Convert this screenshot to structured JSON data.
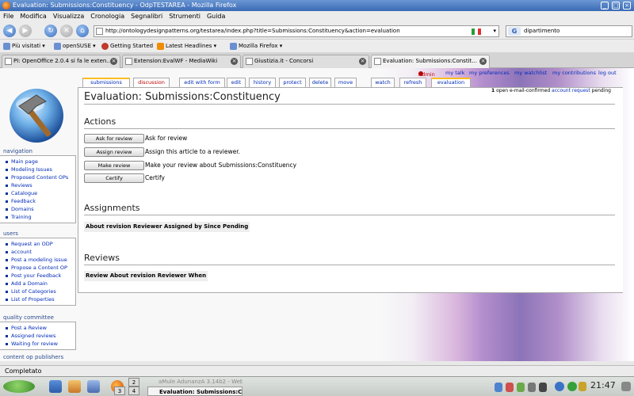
{
  "window": {
    "title": "Evaluation: Submissions:Constituency - OdpTESTAREA - Mozilla Firefox"
  },
  "menubar": [
    "File",
    "Modifica",
    "Visualizza",
    "Cronologia",
    "Segnalibri",
    "Strumenti",
    "Guida"
  ],
  "navbar": {
    "url": "http://ontologydesignpatterns.org/testarea/index.php?title=Submissions:Constituency&action=evaluation",
    "search_value": "dipartimento"
  },
  "bookmarks": [
    "Più visitati",
    "openSUSE",
    "Getting Started",
    "Latest Headlines",
    "Mozilla Firefox"
  ],
  "tabs": [
    {
      "label": "PI: OpenOffice 2.0.4 si fa le exten..."
    },
    {
      "label": "Extension:EvalWF - MediaWiki"
    },
    {
      "label": "Giustizia.it - Concorsi"
    },
    {
      "label": "Evaluation: Submissions:Constit..."
    }
  ],
  "personal": {
    "user": "Admin",
    "items": [
      "my talk",
      "my preferences",
      "my watchlist",
      "my contributions",
      "log out"
    ]
  },
  "ctabs": [
    "submissions",
    "discussion",
    "edit with form",
    "edit",
    "history",
    "protect",
    "delete",
    "move",
    "watch",
    "refresh",
    "evaluation"
  ],
  "page": {
    "title": "Evaluation: Submissions:Constituency",
    "pending_count": "1",
    "pending_text1": "open e-mail-confirmed",
    "pending_link": "account request",
    "pending_text2": "pending"
  },
  "actions": {
    "heading": "Actions",
    "items": [
      {
        "button": "Ask for review",
        "desc": "Ask for review"
      },
      {
        "button": "Assign review",
        "desc": "Assign this article to a reviewer."
      },
      {
        "button": "Make review",
        "desc": "Make your review about Submissions:Constituency"
      },
      {
        "button": "Certify",
        "desc": "Certify"
      }
    ]
  },
  "assignments": {
    "heading": "Assignments",
    "columns": "About revision Reviewer Assigned by Since Pending"
  },
  "reviews": {
    "heading": "Reviews",
    "columns": "Review About revision Reviewer When"
  },
  "sidebar": {
    "navigation": {
      "heading": "navigation",
      "items": [
        "Main page",
        "Modeling Issues",
        "Proposed Content OPs",
        "Reviews",
        "Catalogue",
        "Feedback",
        "Domains",
        "Training"
      ]
    },
    "users": {
      "heading": "users",
      "items": [
        "Request an ODP",
        "account",
        "Post a modeling issue",
        "Propose a Content OP",
        "Post your Feedback",
        "Add a Domain",
        "List of Categories",
        "List of Properties"
      ]
    },
    "quality": {
      "heading": "quality committee",
      "items": [
        "Post a Review",
        "Assigned reviews",
        "Waiting for review"
      ]
    },
    "content_op": {
      "heading": "content op publishers"
    }
  },
  "statusbar": {
    "text": "Completato"
  },
  "taskbar": {
    "pager": [
      "1",
      "2",
      "3",
      "4"
    ],
    "tasks": [
      "aMule AdunanzA 3.14b2 - Web...",
      "Evaluation: Submissions:Const..."
    ],
    "clock": "21:47"
  },
  "colors": {
    "link": "#002bb8",
    "new_link": "#ba0000",
    "selected_tab_accent": "#fabd23",
    "titlebar": "#3a6ab5"
  }
}
